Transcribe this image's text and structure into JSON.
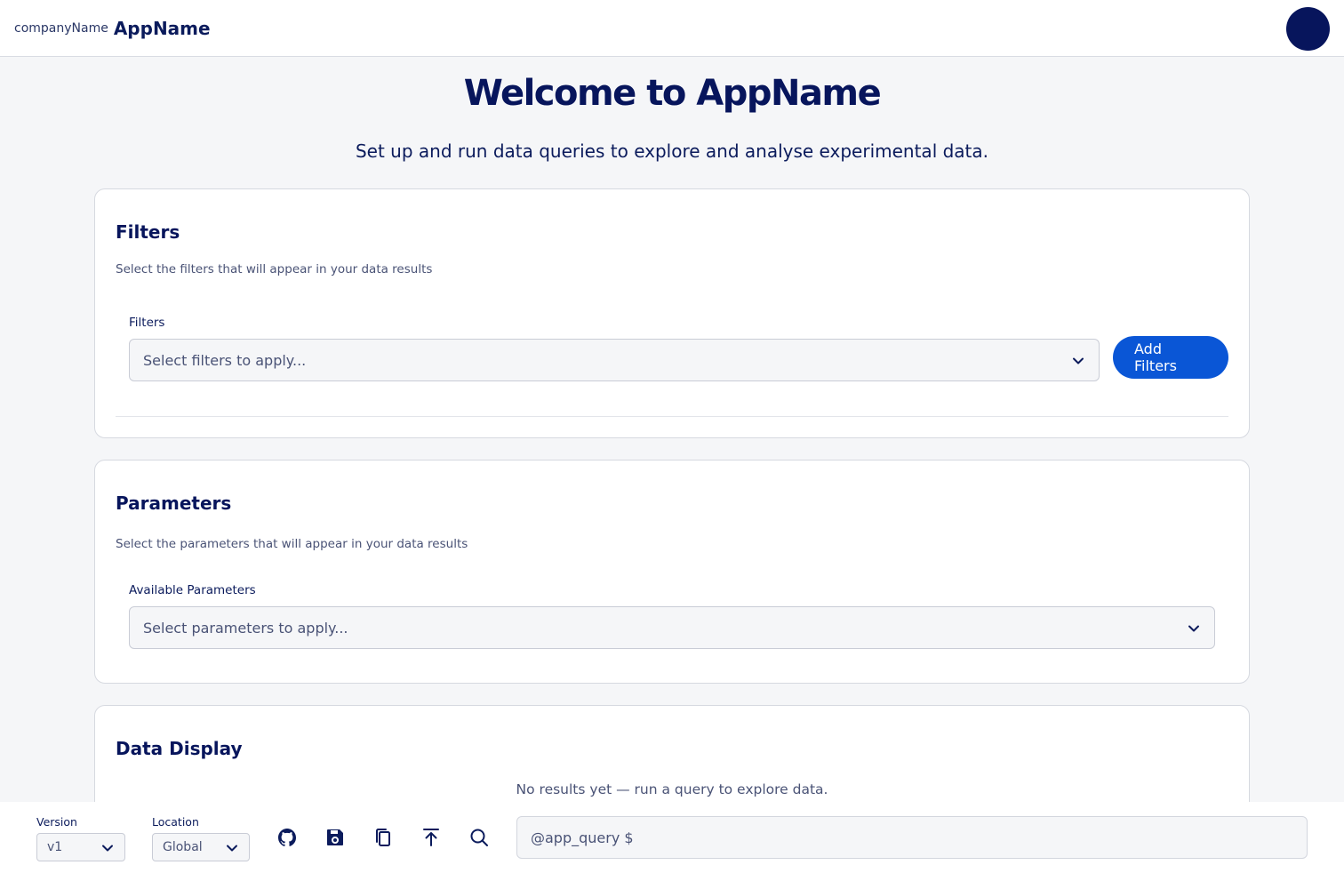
{
  "header": {
    "company": "companyName",
    "app_name": "AppName"
  },
  "hero": {
    "title": "Welcome to AppName",
    "subtitle": "Set up and run data queries to explore and analyse experimental data."
  },
  "filters_card": {
    "title": "Filters",
    "description": "Select the filters that will appear in your data results",
    "field_label": "Filters",
    "select_placeholder": "Select filters to apply...",
    "button_label": "Add Filters"
  },
  "parameters_card": {
    "title": "Parameters",
    "description": "Select the parameters that will appear in your data results",
    "field_label": "Available Parameters",
    "select_placeholder": "Select parameters to apply..."
  },
  "data_card": {
    "title": "Data Display",
    "empty_text": "No results yet — run a query to explore data."
  },
  "bottombar": {
    "version_label": "Version",
    "version_value": "v1",
    "location_label": "Location",
    "location_value": "Global",
    "icons": [
      "github-icon",
      "save-icon",
      "copy-icon",
      "upload-icon",
      "search-icon"
    ],
    "command_placeholder": "@app_query $"
  },
  "colors": {
    "primary": "#0a56d6",
    "navy": "#07155c",
    "background": "#f5f6f8"
  }
}
